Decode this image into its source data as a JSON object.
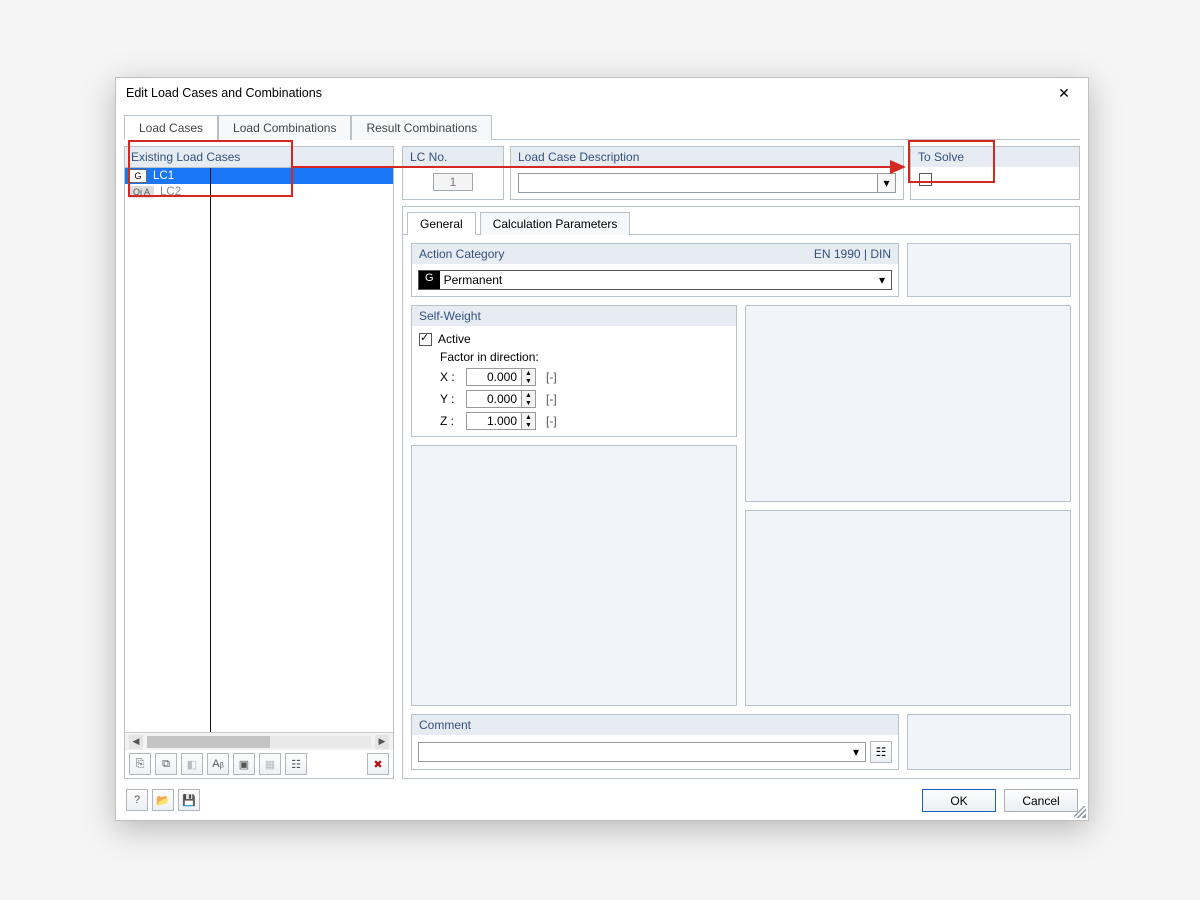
{
  "window": {
    "title": "Edit Load Cases and Combinations",
    "close": "✕"
  },
  "mainTabs": [
    {
      "label": "Load Cases",
      "active": true
    },
    {
      "label": "Load Combinations",
      "active": false
    },
    {
      "label": "Result Combinations",
      "active": false
    }
  ],
  "left": {
    "header": "Existing Load Cases",
    "cases": [
      {
        "tag": "G",
        "name": "LC1",
        "selected": true
      },
      {
        "tag": "Qi A",
        "name": "LC2",
        "selected": false
      }
    ],
    "toolbar_icons": [
      "new",
      "copy",
      "shift",
      "rename",
      "check",
      "grid",
      "tree"
    ],
    "delete_icon": "delete"
  },
  "fields": {
    "lcno": {
      "label": "LC No.",
      "value": "1"
    },
    "lcdesc": {
      "label": "Load Case Description",
      "value": ""
    },
    "tosolve": {
      "label": "To Solve",
      "checked": false
    }
  },
  "innerTabs": [
    {
      "label": "General",
      "active": true
    },
    {
      "label": "Calculation Parameters",
      "active": false
    }
  ],
  "actionCategory": {
    "label": "Action Category",
    "norm": "EN 1990 | DIN",
    "tag": "G",
    "value": "Permanent"
  },
  "selfWeight": {
    "label": "Self-Weight",
    "active_label": "Active",
    "active_checked": true,
    "factor_label": "Factor in direction:",
    "rows": [
      {
        "axis": "X :",
        "value": "0.000",
        "unit": "[-]"
      },
      {
        "axis": "Y :",
        "value": "0.000",
        "unit": "[-]"
      },
      {
        "axis": "Z :",
        "value": "1.000",
        "unit": "[-]"
      }
    ]
  },
  "comment": {
    "label": "Comment",
    "value": ""
  },
  "bottom": {
    "icons": [
      "help",
      "open",
      "save"
    ],
    "ok": "OK",
    "cancel": "Cancel"
  }
}
